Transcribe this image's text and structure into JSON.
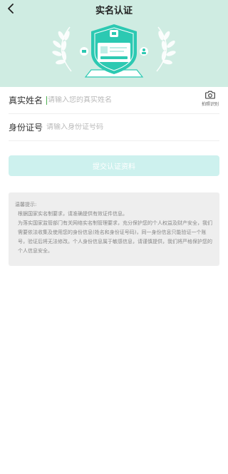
{
  "nav": {
    "title": "实名认证",
    "back_icon": "chevron-left-icon"
  },
  "header": {
    "background": "#cfece2",
    "illustration": "id-verification-shield"
  },
  "form": {
    "name": {
      "label": "真实姓名",
      "placeholder": "请输入您的真实姓名",
      "value": ""
    },
    "id_number": {
      "label": "身份证号",
      "placeholder": "请输入身份证号码",
      "value": ""
    },
    "camera": {
      "icon": "camera-icon",
      "caption": "拍照识别"
    }
  },
  "submit": {
    "label": "提交认证资料",
    "color": "#cdf1ee"
  },
  "tips": {
    "title": "温馨提示:",
    "line1": "根据国家实名制要求，请准确提供有效证件信息。",
    "line2": "为落实国家监管部门有关网络实名制管理要求，充分保护您的个人权益及财产安全，我们需要依法收集及使用您的身份信息(姓名和身份证号码)，同一身份信息只能验证一个账号，验证后将无法修改。个人身份信息属于敏感信息，请谨慎提供，我们将严格保护您的个人信息安全。"
  }
}
